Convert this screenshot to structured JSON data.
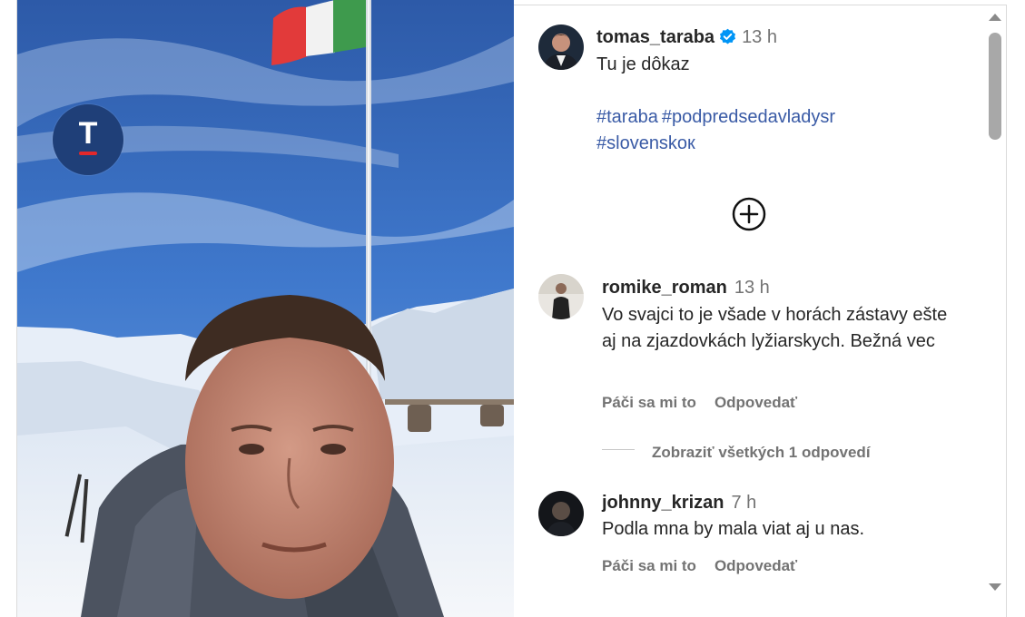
{
  "post": {
    "author": "tomas_taraba",
    "time": "13 h",
    "caption": "Tu je dôkaz",
    "hashtags": [
      "#taraba",
      "#podpredsedavladysr",
      "#slovenskoк"
    ]
  },
  "comments": [
    {
      "user": "romike_roman",
      "time": "13 h",
      "text": "Vo svajci to je všade v horách zástavy ešte aj na zjazdovkách lyžiarskych. Bežná vec",
      "like_label": "Páči sa mi to",
      "reply_label": "Odpovedať",
      "view_replies": "Zobraziť všetkých 1 odpovedí"
    },
    {
      "user": "johnny_krizan",
      "time": "7 h",
      "text": "Podla mna by mala viat aj u nas.",
      "like_label": "Páči sa mi to",
      "reply_label": "Odpovedať"
    }
  ],
  "media": {
    "logo_letter": "T"
  },
  "icons": {
    "verified": "verified-badge-icon",
    "load_more": "plus-circle-icon",
    "scroll_up": "scroll-up-arrow",
    "scroll_down": "scroll-down-arrow"
  },
  "colors": {
    "hashtag": "#3a5ba6",
    "verified": "#0095f6",
    "muted": "#737373",
    "text": "#262626"
  }
}
